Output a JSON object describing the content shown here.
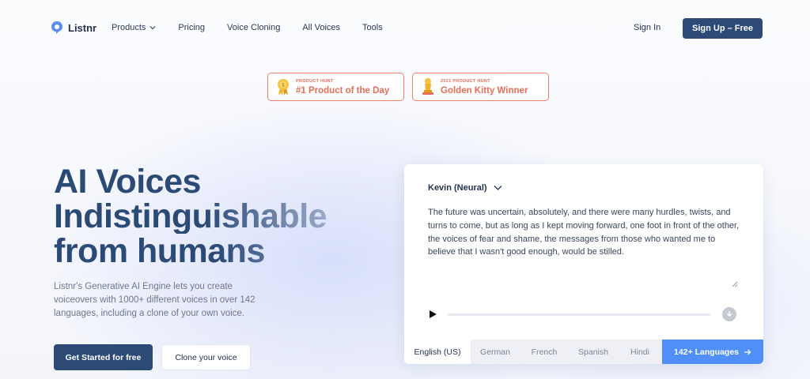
{
  "nav": {
    "logo_text": "Listnr",
    "links": [
      {
        "label": "Products"
      },
      {
        "label": "Pricing"
      },
      {
        "label": "Voice Cloning"
      },
      {
        "label": "All Voices"
      },
      {
        "label": "Tools"
      }
    ],
    "signin_label": "Sign In",
    "signup_label": "Sign Up – Free"
  },
  "badges": [
    {
      "small": "PRODUCT HUNT",
      "big": "#1 Product of the Day",
      "icon": "medal-icon"
    },
    {
      "small": "2021 PRODUCT HUNT",
      "big": "Golden Kitty Winner",
      "icon": "trophy-icon"
    }
  ],
  "hero": {
    "title_line1": "AI Voices",
    "title_line2": "Indistinguishable",
    "title_line3": "from humans",
    "description": "Listnr's Generative AI Engine lets you create voiceovers with 1000+ different voices in over 142 languages, including a clone of your own voice.",
    "primary_cta": "Get Started for free",
    "secondary_cta": "Clone your voice"
  },
  "player": {
    "voice": "Kevin (Neural)",
    "text": "The future was uncertain, absolutely, and there were many hurdles, twists, and turns to come, but as long as I kept moving forward, one foot in front of the other, the voices of fear and shame, the messages from those who wanted me to believe that I wasn't good enough, would be stilled.",
    "progress": 0,
    "languages": [
      "English (US)",
      "German",
      "French",
      "Spanish",
      "Hindi"
    ],
    "active_language": "English (US)",
    "more_languages": "142+ Languages"
  },
  "colors": {
    "brand_navy": "#2c4a76",
    "accent_blue": "#4f8ff7",
    "badge_coral": "#e36e59"
  }
}
